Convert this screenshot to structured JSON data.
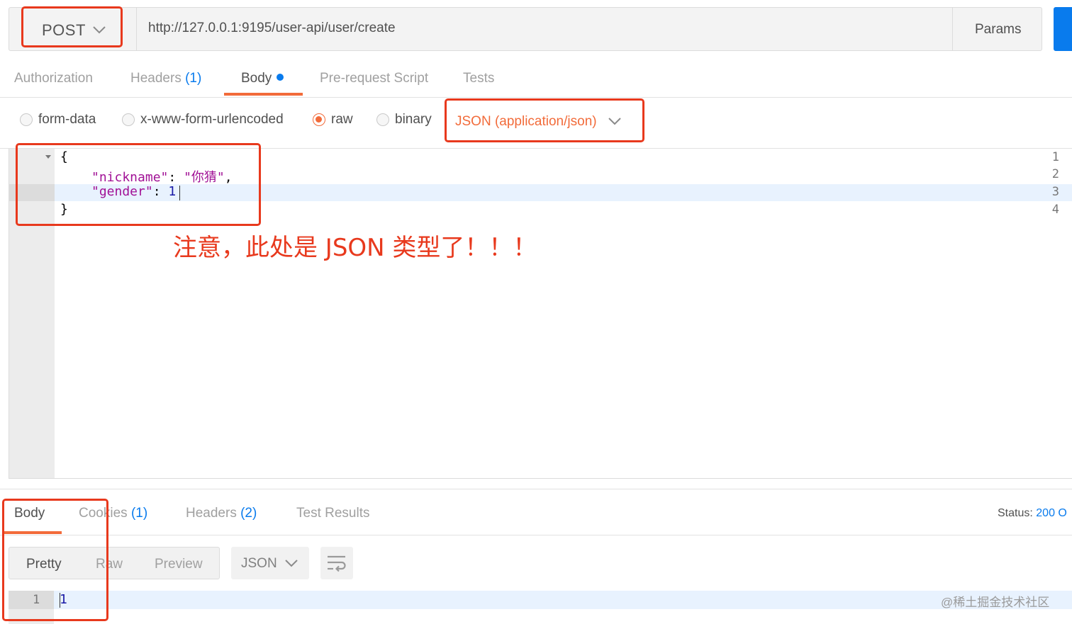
{
  "request": {
    "method": "POST",
    "url": "http://127.0.0.1:9195/user-api/user/create",
    "params_label": "Params"
  },
  "request_tabs": [
    {
      "label": "Authorization",
      "count": ""
    },
    {
      "label": "Headers",
      "count": "(1)"
    },
    {
      "label": "Body",
      "count": ""
    },
    {
      "label": "Pre-request Script",
      "count": ""
    },
    {
      "label": "Tests",
      "count": ""
    }
  ],
  "body_types": [
    {
      "label": "form-data",
      "selected": false
    },
    {
      "label": "x-www-form-urlencoded",
      "selected": false
    },
    {
      "label": "raw",
      "selected": true
    },
    {
      "label": "binary",
      "selected": false
    }
  ],
  "content_type": "JSON (application/json)",
  "editor": {
    "line_numbers": [
      "1",
      "2",
      "3",
      "4"
    ],
    "line1": "{",
    "key_nickname": "\"nickname\"",
    "colon_space": ": ",
    "val_nickname": "\"你猜\"",
    "comma": ",",
    "key_gender": "\"gender\"",
    "val_gender": "1",
    "line4": "}"
  },
  "annotation": "注意，此处是 JSON 类型了！！！",
  "response": {
    "tabs": [
      {
        "label": "Body",
        "count": ""
      },
      {
        "label": "Cookies",
        "count": "(1)"
      },
      {
        "label": "Headers",
        "count": "(2)"
      },
      {
        "label": "Test Results",
        "count": ""
      }
    ],
    "status_label": "Status:",
    "status_value": "200 O",
    "view_modes": [
      "Pretty",
      "Raw",
      "Preview"
    ],
    "format": "JSON",
    "line_number": "1",
    "value": "1"
  },
  "watermark": "@稀土掘金技术社区",
  "colors": {
    "accent": "#f26b3a",
    "link": "#097bed",
    "annotation": "#e8391d"
  }
}
